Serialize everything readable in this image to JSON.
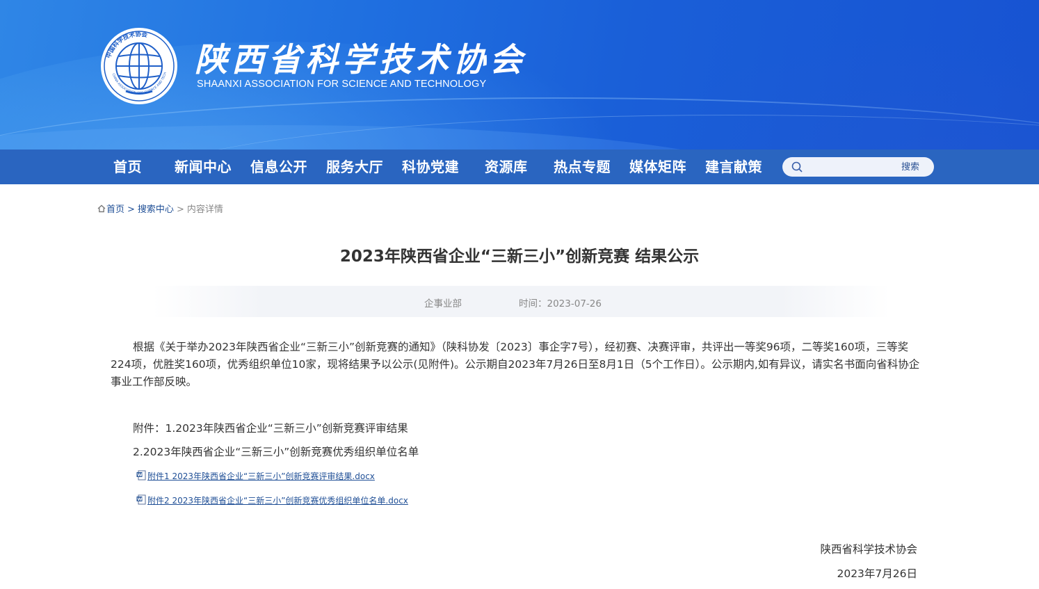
{
  "banner": {
    "brand_cn": "陕西省科学技术协会",
    "brand_en": "SHAANXI ASSOCIATION FOR SCIENCE AND TECHNOLOGY",
    "logo_text": "中国科学技术协会 CHINA ASSOCIATION FOR SCIENCE AND TECHNOLOGY",
    "logo_icon": "cast-globe-logo"
  },
  "nav": {
    "items": [
      {
        "label": "首页"
      },
      {
        "label": "新闻中心"
      },
      {
        "label": "信息公开"
      },
      {
        "label": "服务大厅"
      },
      {
        "label": "科协党建"
      },
      {
        "label": "资源库"
      },
      {
        "label": "热点专题"
      },
      {
        "label": "媒体矩阵"
      },
      {
        "label": "建言献策"
      }
    ],
    "search_placeholder": "",
    "search_button": "搜索",
    "search_icon": "search-icon"
  },
  "breadcrumb": {
    "home": "首页",
    "sep1": ">",
    "level2": "搜索中心",
    "sep2": ">",
    "current": "内容详情"
  },
  "article": {
    "title": "2023年陕西省企业“三新三小”创新竞赛 结果公示",
    "dept": "企事业部",
    "time": "时间：2023-07-26",
    "body": "根据《关于举办2023年陕西省企业“三新三小”创新竞赛的通知》（陕科协发〔2023〕事企字7号），经初赛、决赛评审，共评出一等奖96项，二等奖160项，三等奖224项，优胜奖160项，优秀组织单位10家，现将结果予以公示(见附件)。公示期自2023年7月26日至8月1日（5个工作日）。公示期内,如有异议，请实名书面向省科协企事业工作部反映。",
    "attachment_line1": "附件：1.2023年陕西省企业“三新三小”创新竞赛评审结果",
    "attachment_line2": "2.2023年陕西省企业“三新三小”创新竞赛优秀组织单位名单",
    "file1": "附件1 2023年陕西省企业“三新三小”创新竞赛评审结果.docx",
    "file2": "附件2 2023年陕西省企业“三新三小”创新竞赛优秀组织单位名单.docx",
    "signature": "陕西省科学技术协会",
    "date": "2023年7月26日"
  },
  "colors": {
    "nav_bg": "#2a65c0",
    "banner_blue": "#1f6fe0",
    "link": "#1f4f96",
    "text": "#333333",
    "muted": "#888888"
  }
}
